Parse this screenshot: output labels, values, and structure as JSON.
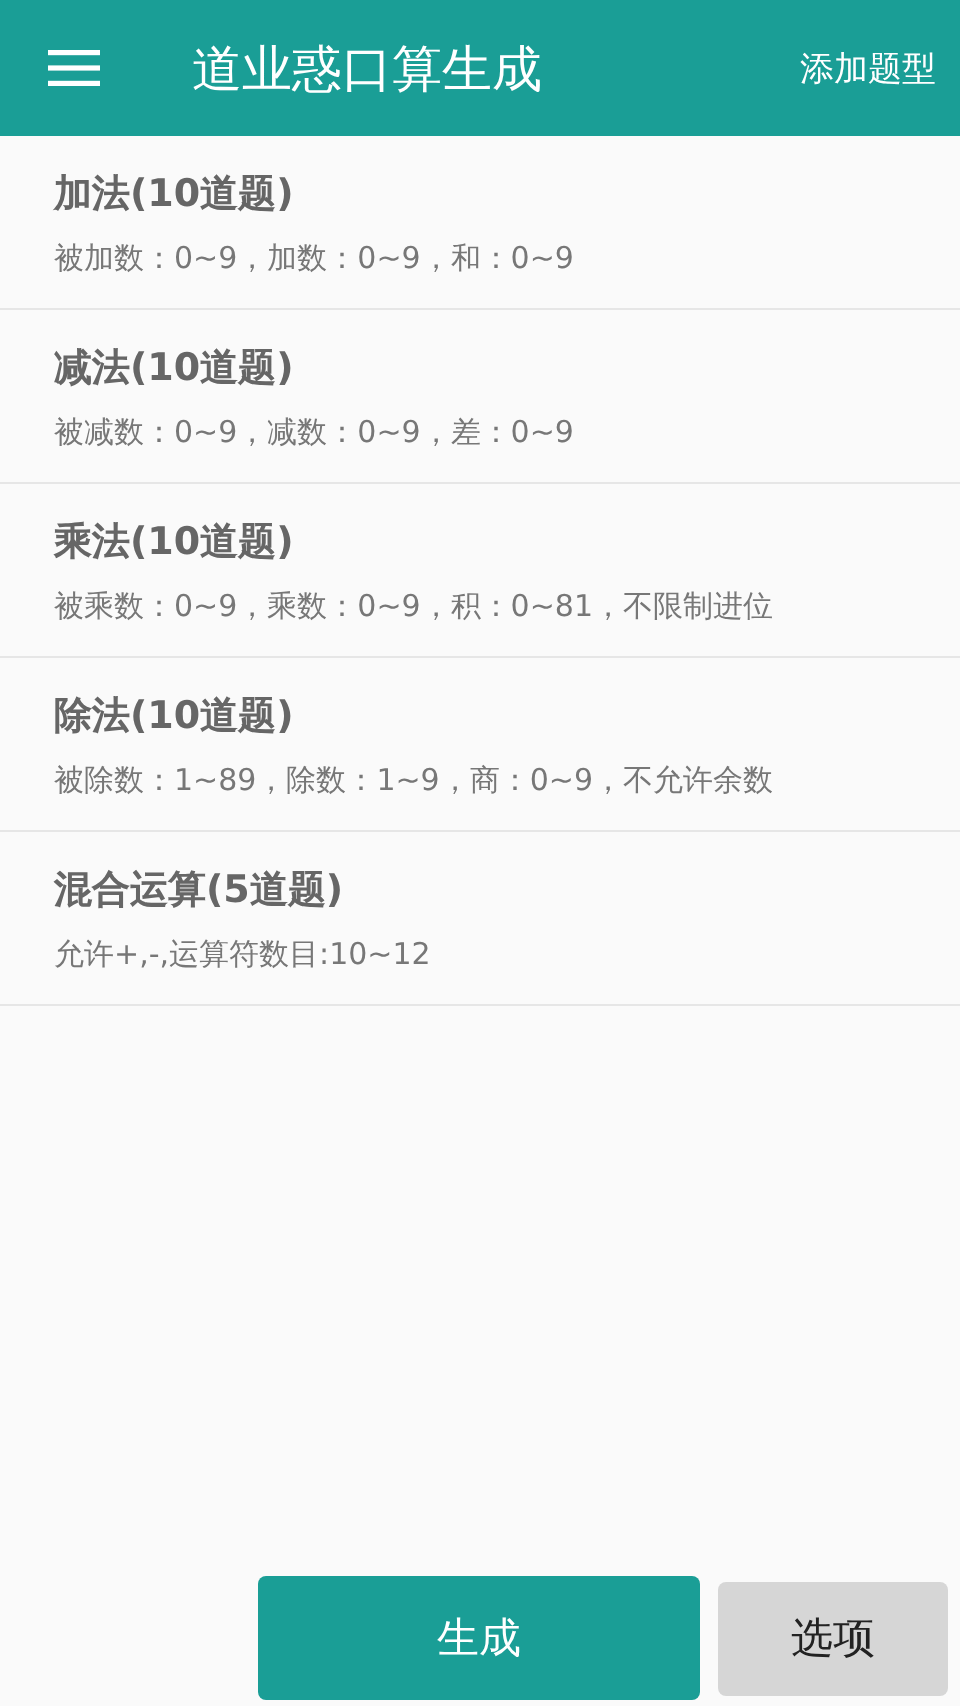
{
  "app_bar": {
    "title": "道业惑口算生成",
    "action": "添加题型"
  },
  "items": [
    {
      "title": "加法(10道题)",
      "detail": "被加数：0~9，加数：0~9，和：0~9"
    },
    {
      "title": "减法(10道题)",
      "detail": "被减数：0~9，减数：0~9，差：0~9"
    },
    {
      "title": "乘法(10道题)",
      "detail": "被乘数：0~9，乘数：0~9，积：0~81，不限制进位"
    },
    {
      "title": "除法(10道题)",
      "detail": "被除数：1~89，除数：1~9，商：0~9，不允许余数"
    },
    {
      "title": "混合运算(5道题)",
      "detail": "允许+,-,运算符数目:10~12"
    }
  ],
  "buttons": [
    {
      "label": "生成",
      "kind": "primary"
    },
    {
      "label": "选项",
      "kind": "secondary"
    }
  ]
}
